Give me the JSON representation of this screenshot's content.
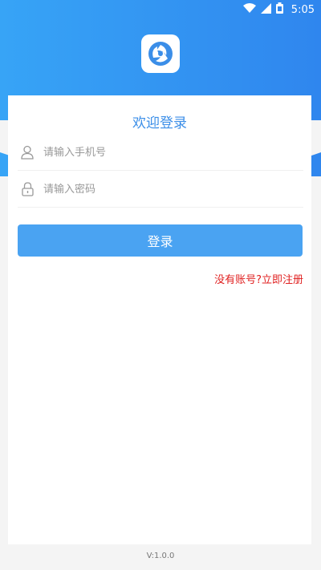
{
  "status_bar": {
    "time": "5:05"
  },
  "login": {
    "title": "欢迎登录",
    "phone_placeholder": "请输入手机号",
    "password_placeholder": "请输入密码",
    "login_button": "登录",
    "register_link": "没有账号?立即注册"
  },
  "footer": {
    "version": "V:1.0.0"
  },
  "colors": {
    "header_gradient_start": "#37a4f6",
    "header_gradient_end": "#2f86ee",
    "accent": "#4aa3f2",
    "title": "#3b8ee8",
    "link": "#e02020"
  },
  "icons": [
    "wifi-icon",
    "signal-icon",
    "battery-icon",
    "app-logo-icon",
    "user-icon",
    "lock-icon"
  ]
}
